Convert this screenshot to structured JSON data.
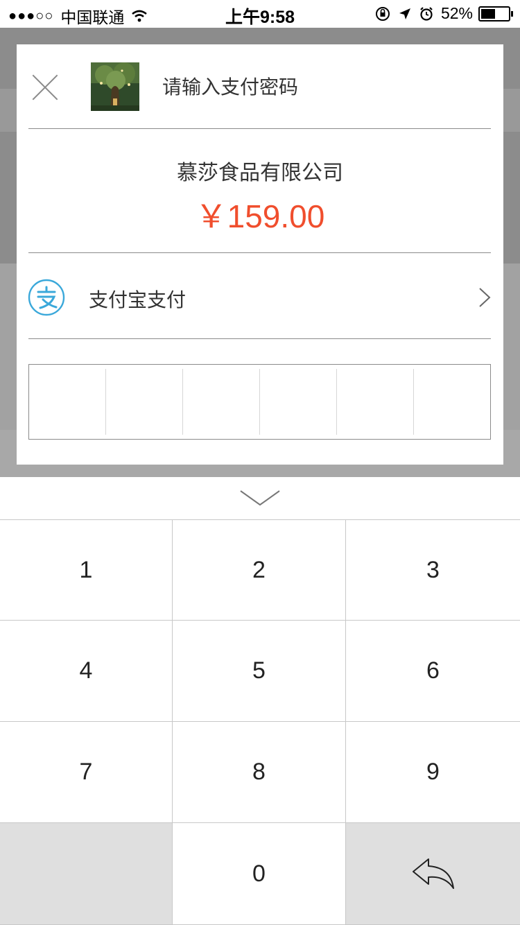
{
  "status_bar": {
    "signal": "●●●○○",
    "carrier": "中国联通",
    "time": "上午9:58",
    "battery": "52%",
    "battery_level": 0.52,
    "icons": [
      "wifi-icon",
      "rotation-lock-icon",
      "location-icon",
      "alarm-icon",
      "battery-icon"
    ]
  },
  "dialog": {
    "title": "请输入支付密码",
    "merchant": "慕莎食品有限公司",
    "amount": "￥159.00",
    "payment_method": "支付宝支付",
    "password_length": 6
  },
  "keypad": {
    "keys": [
      "1",
      "2",
      "3",
      "4",
      "5",
      "6",
      "7",
      "8",
      "9",
      "",
      "0",
      ""
    ]
  },
  "colors": {
    "amount": "#f04e2d",
    "alipay_blue": "#3aa8da",
    "divider": "#8a8a8a",
    "key_gray": "#dfdfdf"
  }
}
